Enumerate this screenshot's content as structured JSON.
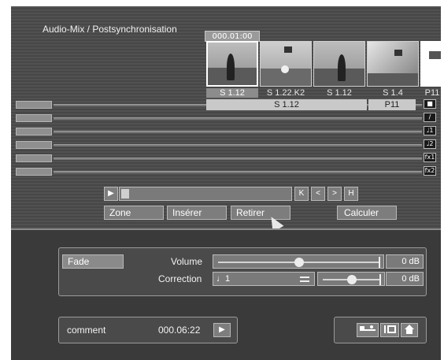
{
  "window": {
    "title": "Audio-Mix / Postsynchronisation"
  },
  "timeline": {
    "timecode": "000.01:00",
    "thumbnails": [
      {
        "label": "S 1.12",
        "selected": true
      },
      {
        "label": "S 1.22.K2",
        "selected": false
      },
      {
        "label": "S 1.12",
        "selected": false
      },
      {
        "label": "S 1.4",
        "selected": false
      },
      {
        "label": "P11",
        "selected": false
      }
    ],
    "video_track": {
      "clip1": "S 1.12",
      "clip2": "P11"
    },
    "track_icons": [
      "camera-icon",
      "pencil-icon",
      "music-1-icon",
      "music-2-icon",
      "fx1-icon",
      "fx2-icon"
    ],
    "track_icon_labels": [
      "",
      "",
      "♩1",
      "♩2",
      "fx1",
      "fx2"
    ]
  },
  "transport": {
    "play_symbol": "▶",
    "first_symbol": "K",
    "prev_symbol": "<",
    "next_symbol": ">",
    "last_symbol": "H"
  },
  "actions": {
    "zone": "Zone",
    "inserer": "Insérer",
    "retirer": "Retirer",
    "calculer": "Calculer"
  },
  "mixer": {
    "fade_label": "Fade",
    "volume_label": "Volume",
    "volume_db": "0 dB",
    "volume_level": 0.5,
    "correction_label": "Correction",
    "correction_value": "♩1",
    "correction_db": "0 dB",
    "correction_level": 0.5
  },
  "footer": {
    "comment_label": "comment",
    "time": "000.06:22",
    "play_symbol": "▶",
    "tool_icons": [
      "scissors-track-icon",
      "music-edit-icon",
      "home-icon"
    ]
  }
}
